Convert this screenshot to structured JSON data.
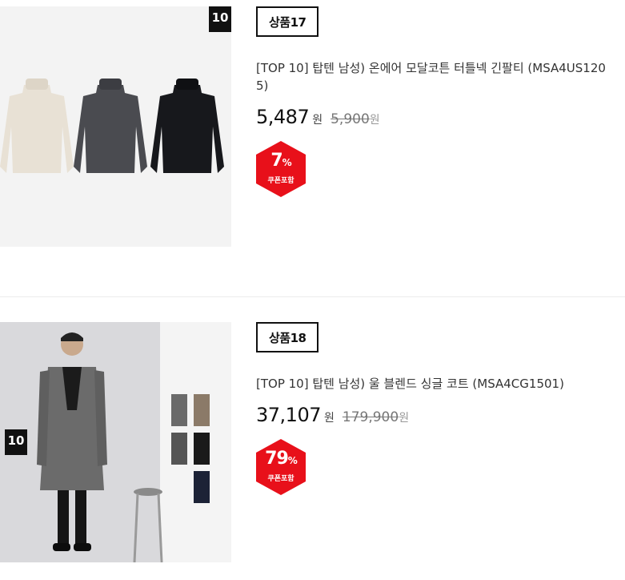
{
  "products": [
    {
      "number": "상품17",
      "title": "[TOP 10] 탑텐 남성) 온에어 모달코튼 터틀넥 긴팔티 (MSA4US1205)",
      "sale_price": "5,487",
      "currency": "원",
      "original_price": "5,900",
      "discount_percent": "7",
      "percent_sign": "%",
      "coupon_label": "쿠폰포함",
      "brand_logo": "10",
      "colors": {
        "badge": "#e8101a",
        "sweater_1": "#e8e1d5",
        "sweater_2": "#4a4b50",
        "sweater_3": "#17181c"
      }
    },
    {
      "number": "상품18",
      "title": "[TOP 10] 탑텐 남성) 울 블렌드 싱글 코트 (MSA4CG1501)",
      "sale_price": "37,107",
      "currency": "원",
      "original_price": "179,900",
      "discount_percent": "79",
      "percent_sign": "%",
      "coupon_label": "쿠폰포함",
      "brand_logo": "10",
      "colors": {
        "badge": "#e8101a",
        "coat": "#6b6b6b"
      }
    }
  ]
}
